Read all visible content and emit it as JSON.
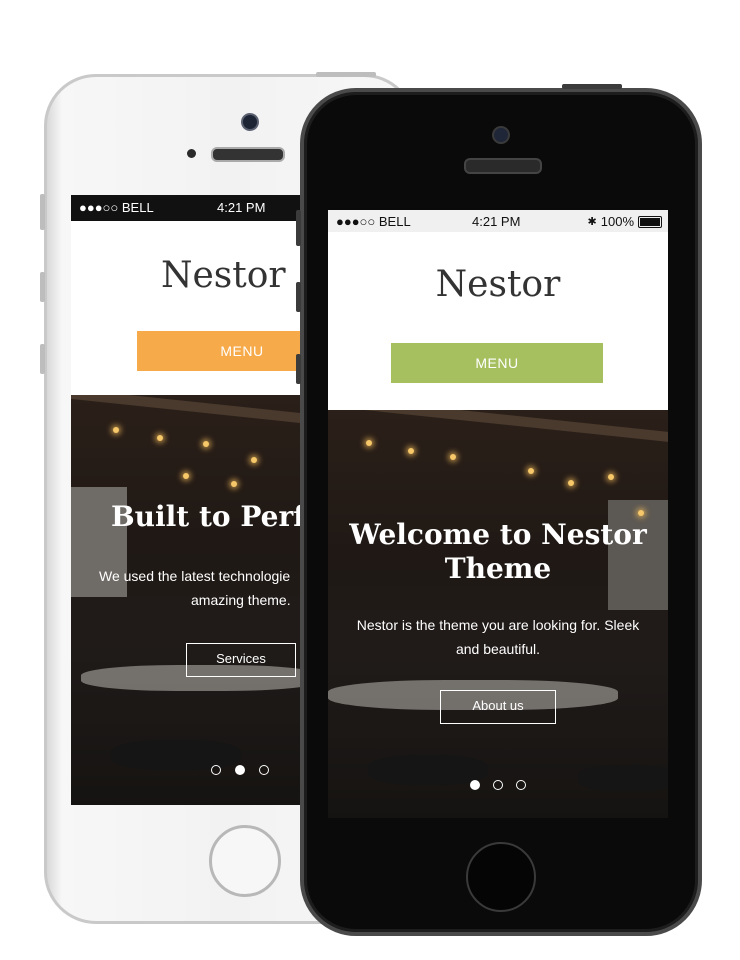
{
  "colors": {
    "orange_menu": "#f7aa4a",
    "green_menu": "#a6c060",
    "white_phone": "#f2f2f2",
    "black_phone": "#0a0a0a"
  },
  "white_phone": {
    "status": {
      "carrier": "●●●○○ BELL",
      "time": "4:21 PM"
    },
    "brand": "Nestor",
    "menu_label": "MENU",
    "hero": {
      "title": "Built to Perfe",
      "text_line1": "We used the latest technologie",
      "text_line2": "amazing theme.",
      "button": "Services",
      "slides_total": 3,
      "active_slide": 2
    }
  },
  "black_phone": {
    "status": {
      "carrier": "●●●○○ BELL",
      "time": "4:21 PM",
      "bluetooth": "✱",
      "battery": "100%"
    },
    "brand": "Nestor",
    "menu_label": "MENU",
    "hero": {
      "title_line1": "Welcome to Nestor",
      "title_line2": "Theme",
      "text_line1": "Nestor is the theme you are looking for. Sleek",
      "text_line2": "and beautiful.",
      "button": "About us",
      "slides_total": 3,
      "active_slide": 1
    }
  }
}
